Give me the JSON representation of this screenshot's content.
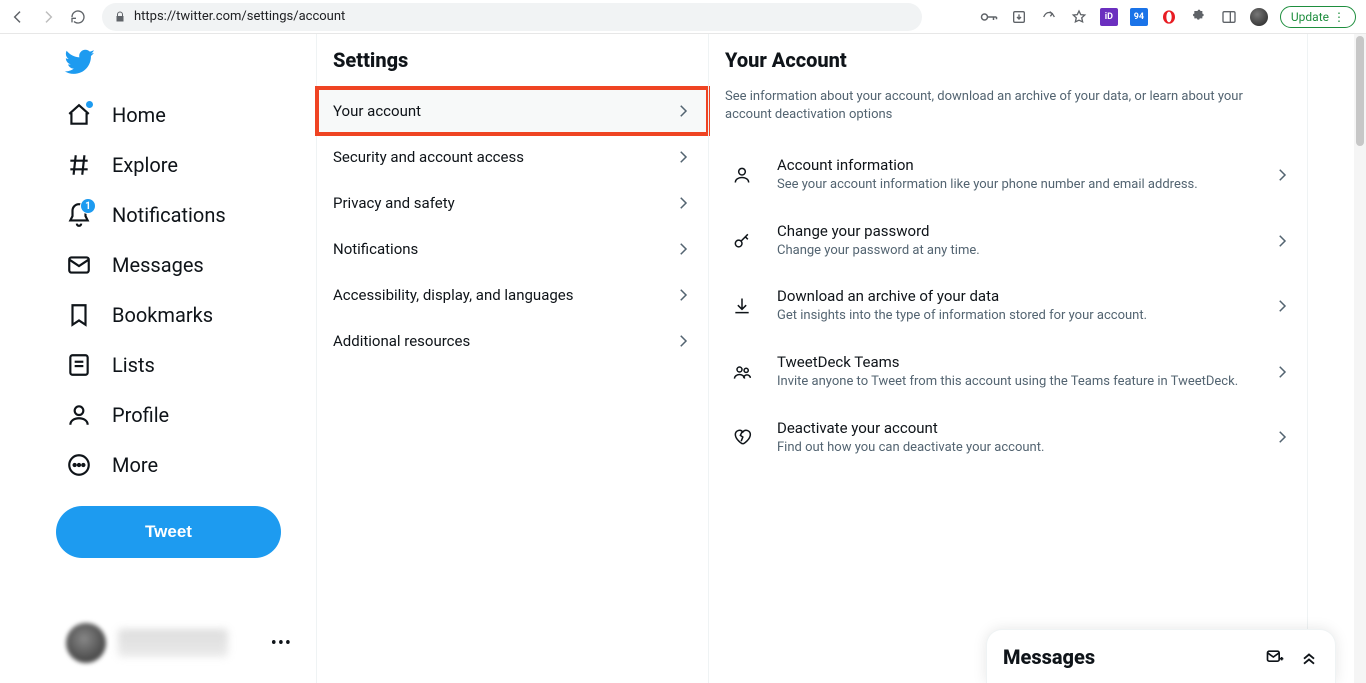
{
  "browser": {
    "url": "https://twitter.com/settings/account",
    "update_label": "Update",
    "ext_badge_number": "94"
  },
  "sidebar": {
    "items": [
      {
        "label": "Home"
      },
      {
        "label": "Explore"
      },
      {
        "label": "Notifications",
        "badge": "1"
      },
      {
        "label": "Messages"
      },
      {
        "label": "Bookmarks"
      },
      {
        "label": "Lists"
      },
      {
        "label": "Profile"
      },
      {
        "label": "More"
      }
    ],
    "tweet_label": "Tweet"
  },
  "settings": {
    "title": "Settings",
    "items": [
      {
        "label": "Your account"
      },
      {
        "label": "Security and account access"
      },
      {
        "label": "Privacy and safety"
      },
      {
        "label": "Notifications"
      },
      {
        "label": "Accessibility, display, and languages"
      },
      {
        "label": "Additional resources"
      }
    ]
  },
  "detail": {
    "title": "Your Account",
    "description": "See information about your account, download an archive of your data, or learn about your account deactivation options",
    "items": [
      {
        "title": "Account information",
        "desc": "See your account information like your phone number and email address."
      },
      {
        "title": "Change your password",
        "desc": "Change your password at any time."
      },
      {
        "title": "Download an archive of your data",
        "desc": "Get insights into the type of information stored for your account."
      },
      {
        "title": "TweetDeck Teams",
        "desc": "Invite anyone to Tweet from this account using the Teams feature in TweetDeck."
      },
      {
        "title": "Deactivate your account",
        "desc": "Find out how you can deactivate your account."
      }
    ]
  },
  "messages_drawer": {
    "title": "Messages"
  }
}
